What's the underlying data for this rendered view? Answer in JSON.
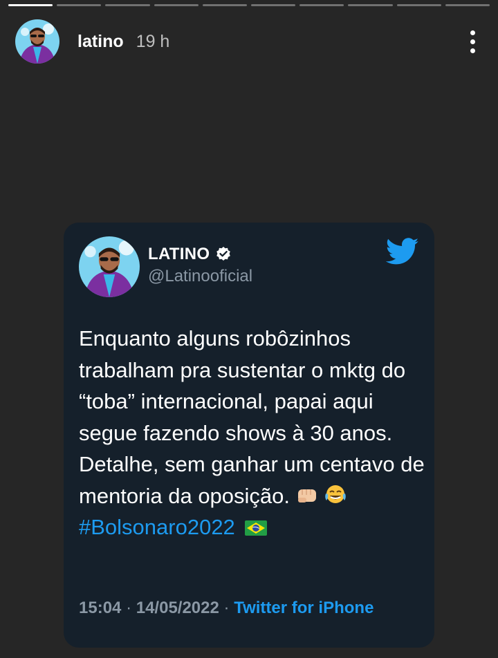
{
  "story": {
    "progress": {
      "total_segments": 10,
      "current_segment": 1,
      "current_fraction": 1.0
    },
    "username": "latino",
    "time_ago": "19 h"
  },
  "tweet": {
    "display_name": "LATINO",
    "handle": "@Latinooficial",
    "text": "Enquanto alguns robôzinhos trabalham pra sustentar o mktg do “toba” internacional, papai aqui segue fazendo shows à 30 anos. Detalhe, sem ganhar um centavo de mentoria da oposição.",
    "emojis": [
      "fist-bump-emoji",
      "tears-of-joy-emoji"
    ],
    "hashtag": "#Bolsonaro2022",
    "flag_icon": "brazil-flag-icon",
    "time": "15:04",
    "date": "14/05/2022",
    "source": "Twitter for iPhone",
    "separator": "·"
  },
  "colors": {
    "background": "#262626",
    "card": "#15202b",
    "accent_blue": "#1d9bf0",
    "muted_text": "#8b98a5"
  }
}
